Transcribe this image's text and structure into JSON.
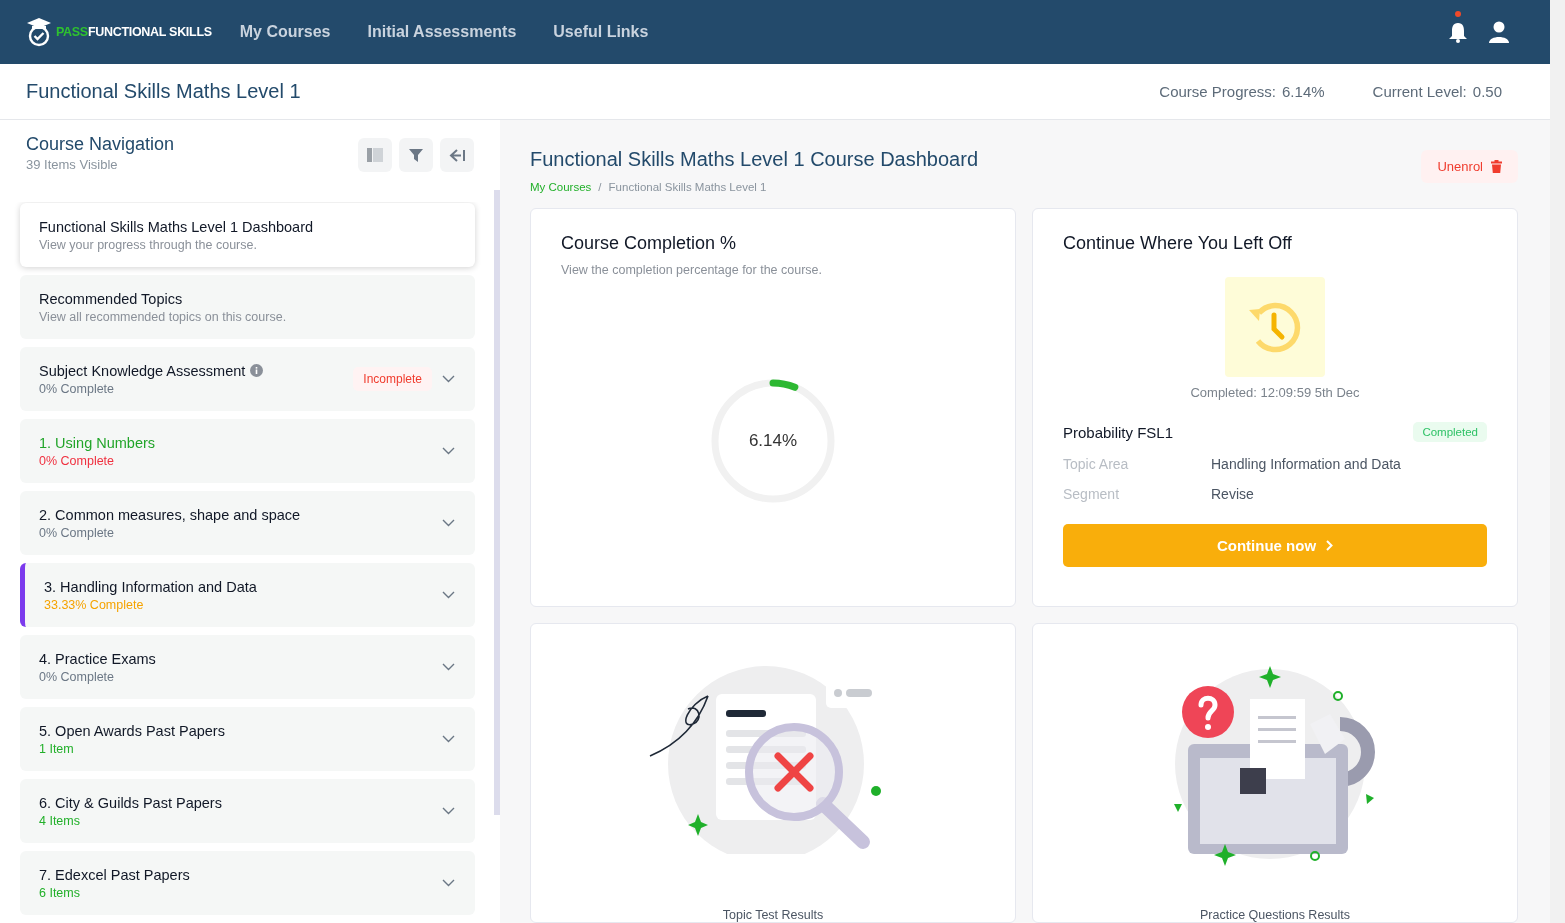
{
  "header": {
    "logo": {
      "accent": "PASS",
      "text": "FUNCTIONAL SKILLS"
    },
    "nav": [
      {
        "label": "My Courses"
      },
      {
        "label": "Initial Assessments"
      },
      {
        "label": "Useful Links"
      }
    ],
    "notifications": {
      "unread": true
    }
  },
  "course_bar": {
    "title": "Functional Skills Maths Level 1",
    "stats": [
      {
        "label": "Course Progress:",
        "value": "6.14%"
      },
      {
        "label": "Current Level:",
        "value": "0.50"
      }
    ]
  },
  "sidebar": {
    "title": "Course Navigation",
    "subtitle": "39 Items Visible",
    "items": [
      {
        "title": "Functional Skills Maths Level 1 Dashboard",
        "detail": "View your progress through the course.",
        "color": "#8a9099",
        "selected": true,
        "current": false,
        "highlighted": false,
        "expandable": false
      },
      {
        "title": "Recommended Topics",
        "detail": "View all recommended topics on this course.",
        "color": "#8a9099",
        "selected": false,
        "current": false,
        "highlighted": false,
        "expandable": false
      },
      {
        "title": "Subject Knowledge Assessment",
        "info": true,
        "badge": "Incomplete",
        "detail": "0% Complete",
        "color": "#6b7785",
        "selected": false,
        "current": false,
        "highlighted": false,
        "expandable": true
      },
      {
        "title": "1. Using Numbers",
        "detail": "0% Complete",
        "color": "#f0303f",
        "selected": false,
        "current": false,
        "highlighted": true,
        "expandable": true
      },
      {
        "title": "2. Common measures, shape and space",
        "detail": "0% Complete",
        "color": "#6b7785",
        "selected": false,
        "current": false,
        "highlighted": false,
        "expandable": true
      },
      {
        "title": "3. Handling Information and Data",
        "detail": "33.33% Complete",
        "color": "#f5a300",
        "selected": false,
        "current": true,
        "highlighted": false,
        "expandable": true
      },
      {
        "title": "4. Practice Exams",
        "detail": "0% Complete",
        "color": "#6b7785",
        "selected": false,
        "current": false,
        "highlighted": false,
        "expandable": true
      },
      {
        "title": "5. Open Awards Past Papers",
        "detail": "1 Item",
        "color": "#22b02a",
        "selected": false,
        "current": false,
        "highlighted": false,
        "expandable": true
      },
      {
        "title": "6. City & Guilds Past Papers",
        "detail": "4 Items",
        "color": "#22b02a",
        "selected": false,
        "current": false,
        "highlighted": false,
        "expandable": true
      },
      {
        "title": "7. Edexcel Past Papers",
        "detail": "6 Items",
        "color": "#22b02a",
        "selected": false,
        "current": false,
        "highlighted": false,
        "expandable": true
      }
    ]
  },
  "main": {
    "title": "Functional Skills Maths Level 1 Course Dashboard",
    "breadcrumb": [
      {
        "label": "My Courses",
        "link": true
      },
      {
        "label": "Functional Skills Maths Level 1",
        "link": false
      }
    ],
    "breadcrumb_separator": "/",
    "unenrol_button": "Unenrol",
    "completion": {
      "title": "Course Completion %",
      "subtitle": "View the completion percentage for the course.",
      "level": 0.0614,
      "reading": "6.14%"
    },
    "continue": {
      "title": "Continue Where You Left Off",
      "completed_at": "Completed: 12:09:59 5th Dec",
      "topic": "Probability FSL1",
      "status": "Completed",
      "details": [
        {
          "label": "Topic Area",
          "value": "Handling Information and Data"
        },
        {
          "label": "Segment",
          "value": "Revise"
        }
      ],
      "button": "Continue now"
    },
    "result_cards": [
      {
        "kind": "topic",
        "caption": "Topic Test Results"
      },
      {
        "kind": "practice",
        "caption": "Practice Questions Results"
      }
    ]
  }
}
